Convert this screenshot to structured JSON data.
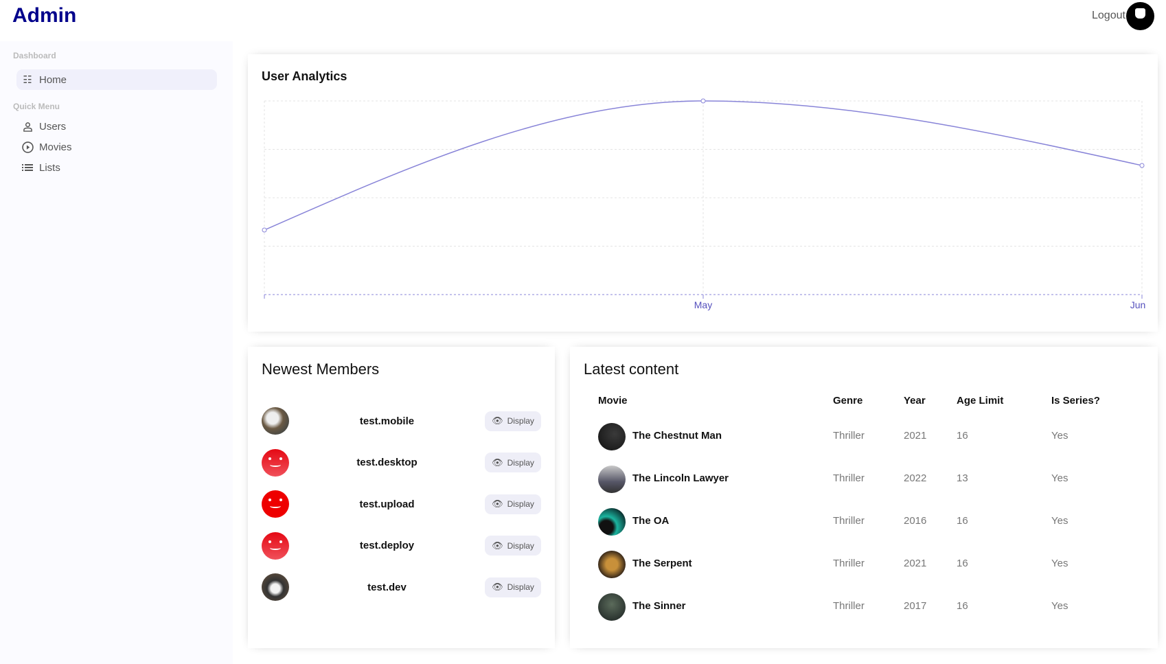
{
  "header": {
    "title": "Admin",
    "logout_label": "Logout"
  },
  "sidebar": {
    "sections": [
      {
        "title": "Dashboard",
        "items": [
          {
            "label": "Home",
            "icon": "timeline-icon",
            "active": true
          }
        ]
      },
      {
        "title": "Quick Menu",
        "items": [
          {
            "label": "Users",
            "icon": "user-icon"
          },
          {
            "label": "Movies",
            "icon": "play-circle-icon"
          },
          {
            "label": "Lists",
            "icon": "list-icon"
          }
        ]
      }
    ]
  },
  "analytics": {
    "title": "User Analytics"
  },
  "chart_data": {
    "type": "line",
    "categories": [
      "",
      "May",
      "Jun"
    ],
    "series": [
      {
        "values": [
          1,
          3,
          2
        ],
        "color": "#8884d8"
      }
    ],
    "ylim": [
      0,
      3
    ],
    "grid": true,
    "xlabel": "",
    "ylabel": ""
  },
  "members": {
    "title": "Newest Members",
    "button_label": "Display",
    "items": [
      {
        "username": "test.mobile",
        "avatar": "cat-photo"
      },
      {
        "username": "test.desktop",
        "avatar": "red-smile"
      },
      {
        "username": "test.upload",
        "avatar": "red-monster"
      },
      {
        "username": "test.deploy",
        "avatar": "red-smile"
      },
      {
        "username": "test.dev",
        "avatar": "cat-photo-bw"
      }
    ]
  },
  "content": {
    "title": "Latest content",
    "columns": [
      "Movie",
      "Genre",
      "Year",
      "Age Limit",
      "Is Series?"
    ],
    "rows": [
      {
        "movie": "The Chestnut Man",
        "genre": "Thriller",
        "year": "2021",
        "age": "16",
        "series": "Yes"
      },
      {
        "movie": "The Lincoln Lawyer",
        "genre": "Thriller",
        "year": "2022",
        "age": "13",
        "series": "Yes"
      },
      {
        "movie": "The OA",
        "genre": "Thriller",
        "year": "2016",
        "age": "16",
        "series": "Yes"
      },
      {
        "movie": "The Serpent",
        "genre": "Thriller",
        "year": "2021",
        "age": "16",
        "series": "Yes"
      },
      {
        "movie": "The Sinner",
        "genre": "Thriller",
        "year": "2017",
        "age": "16",
        "series": "Yes"
      }
    ]
  }
}
